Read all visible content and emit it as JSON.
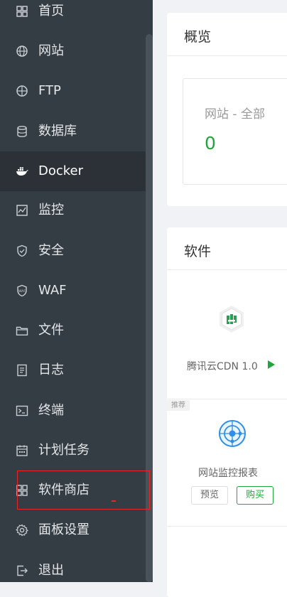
{
  "sidebar": {
    "items": [
      {
        "label": "首页",
        "icon": "home-icon"
      },
      {
        "label": "网站",
        "icon": "globe-icon"
      },
      {
        "label": "FTP",
        "icon": "ftp-globe-icon"
      },
      {
        "label": "数据库",
        "icon": "database-icon"
      },
      {
        "label": "Docker",
        "icon": "docker-icon"
      },
      {
        "label": "监控",
        "icon": "monitor-icon"
      },
      {
        "label": "安全",
        "icon": "shield-icon"
      },
      {
        "label": "WAF",
        "icon": "waf-shield-icon"
      },
      {
        "label": "文件",
        "icon": "folder-icon"
      },
      {
        "label": "日志",
        "icon": "log-icon"
      },
      {
        "label": "终端",
        "icon": "terminal-icon"
      },
      {
        "label": "计划任务",
        "icon": "calendar-icon"
      },
      {
        "label": "软件商店",
        "icon": "apps-grid-icon"
      },
      {
        "label": "面板设置",
        "icon": "gear-icon"
      },
      {
        "label": "退出",
        "icon": "logout-icon"
      }
    ],
    "active_label": "Docker",
    "waf_badge": "WAF"
  },
  "overview": {
    "title": "概览",
    "site_stat_label": "网站 - 全部",
    "site_stat_value": "0"
  },
  "software": {
    "title": "软件",
    "item_name": "腾讯云CDN 1.0",
    "recommended_tag": "推荐",
    "recommended_name": "网站监控报表",
    "preview_label": "预览",
    "buy_label": "购买"
  },
  "colors": {
    "sidebar_bg": "#353d44",
    "active_bg": "#2b3137",
    "accent_green": "#20a53a",
    "highlight_red": "#e5252a"
  }
}
